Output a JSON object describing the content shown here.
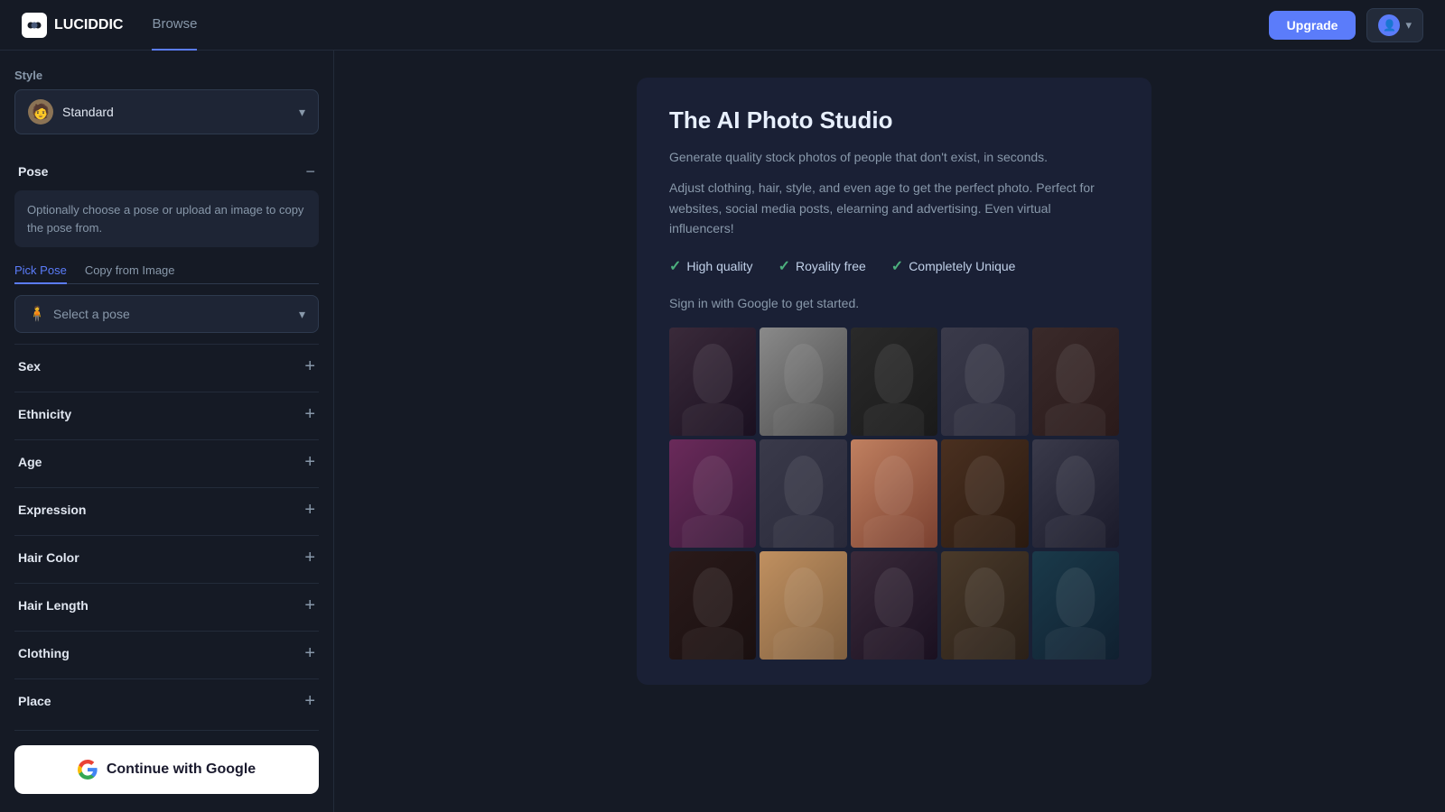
{
  "app": {
    "name": "LUCIDDIC"
  },
  "header": {
    "nav": [
      {
        "label": "Browse",
        "active": false
      }
    ],
    "upgrade_label": "Upgrade",
    "user_icon": "👤",
    "chevron": "▾"
  },
  "sidebar": {
    "style_label": "Style",
    "style_value": "Standard",
    "pose_label": "Pose",
    "pose_hint": "Optionally choose a pose or upload an image to copy the pose from.",
    "pose_tab_pick": "Pick Pose",
    "pose_tab_copy": "Copy from Image",
    "pose_select_placeholder": "Select a pose",
    "sex_label": "Sex",
    "ethnicity_label": "Ethnicity",
    "age_label": "Age",
    "expression_label": "Expression",
    "hair_color_label": "Hair Color",
    "hair_length_label": "Hair Length",
    "clothing_label": "Clothing",
    "place_label": "Place",
    "google_btn_label": "Continue with Google"
  },
  "main": {
    "title": "The AI Photo Studio",
    "desc1": "Generate quality stock photos of people that don't exist, in seconds.",
    "desc2": "Adjust clothing, hair, style, and even age to get the perfect photo. Perfect for websites, social media posts, elearning and advertising. Even virtual influencers!",
    "features": [
      {
        "label": "High quality"
      },
      {
        "label": "Royality free"
      },
      {
        "label": "Completely Unique"
      }
    ],
    "signin_text": "Sign in with Google to get started.",
    "photos": [
      {
        "id": 1,
        "cls": "p1"
      },
      {
        "id": 2,
        "cls": "p2"
      },
      {
        "id": 3,
        "cls": "p3"
      },
      {
        "id": 4,
        "cls": "p4"
      },
      {
        "id": 5,
        "cls": "p5"
      },
      {
        "id": 6,
        "cls": "p6"
      },
      {
        "id": 7,
        "cls": "p7"
      },
      {
        "id": 8,
        "cls": "p8"
      },
      {
        "id": 9,
        "cls": "p9"
      },
      {
        "id": 10,
        "cls": "p10"
      },
      {
        "id": 11,
        "cls": "p11"
      },
      {
        "id": 12,
        "cls": "p12"
      },
      {
        "id": 13,
        "cls": "p13"
      },
      {
        "id": 14,
        "cls": "p14"
      },
      {
        "id": 15,
        "cls": "p15"
      }
    ]
  }
}
